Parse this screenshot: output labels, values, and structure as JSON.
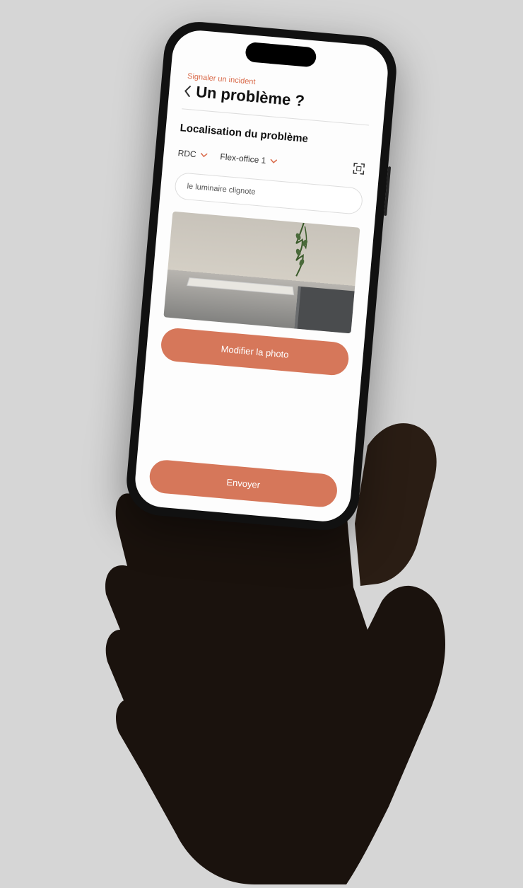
{
  "header": {
    "breadcrumb": "Signaler un incident",
    "title": "Un problème ?"
  },
  "section": {
    "title": "Localisation du problème"
  },
  "dropdowns": {
    "floor": "RDC",
    "room": "Flex-office 1"
  },
  "description": {
    "value": "le luminaire clignote"
  },
  "buttons": {
    "modify_photo": "Modifier la photo",
    "submit": "Envoyer"
  },
  "colors": {
    "accent": "#d6775a"
  }
}
